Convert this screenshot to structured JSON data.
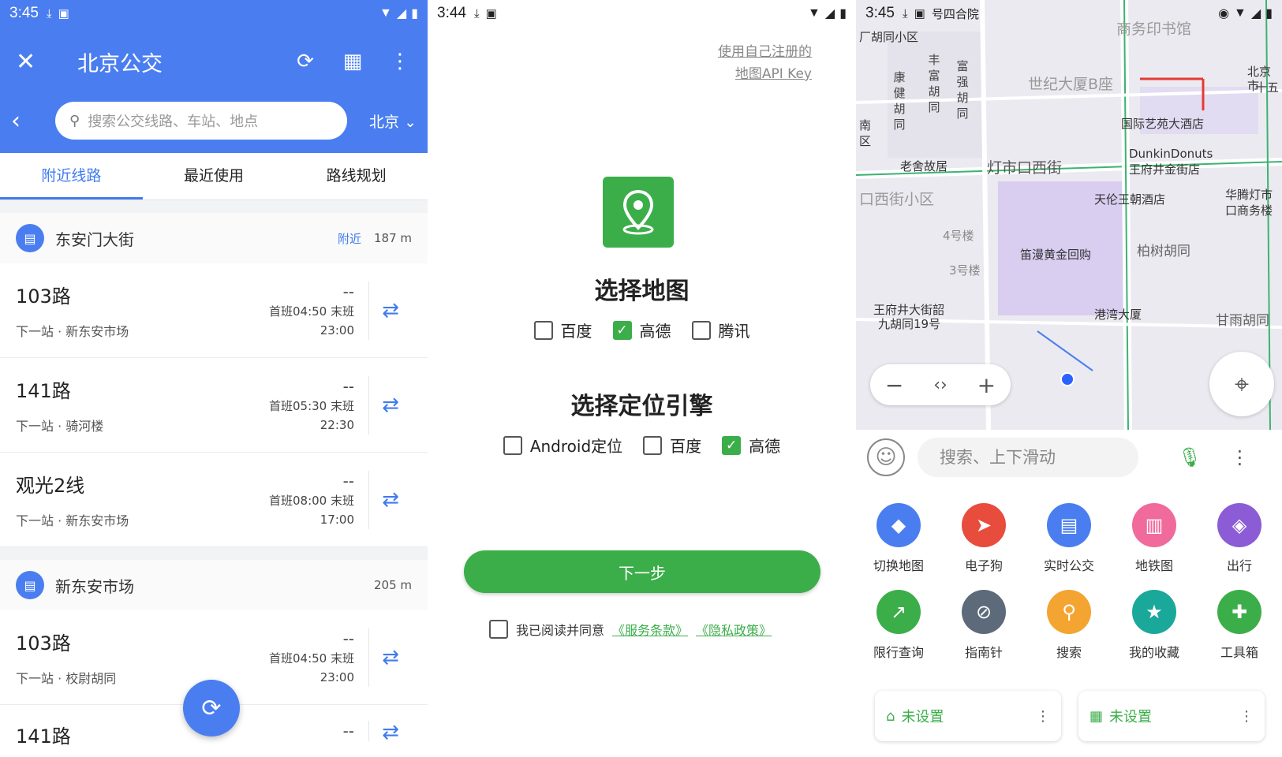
{
  "screen1": {
    "status_time": "3:45",
    "title": "北京公交",
    "search_placeholder": "搜索公交线路、车站、地点",
    "city": "北京",
    "tabs": [
      "附近线路",
      "最近使用",
      "路线规划"
    ],
    "stops": [
      {
        "name": "东安门大街",
        "near": "附近",
        "distance": "187 m",
        "routes": [
          {
            "name": "103路",
            "next": "下一站 · 新东安市场",
            "eta": "--",
            "first": "首班04:50 末班",
            "last": "23:00"
          },
          {
            "name": "141路",
            "next": "下一站 · 骑河楼",
            "eta": "--",
            "first": "首班05:30 末班",
            "last": "22:30"
          },
          {
            "name": "观光2线",
            "next": "下一站 · 新东安市场",
            "eta": "--",
            "first": "首班08:00 末班",
            "last": "17:00"
          }
        ]
      },
      {
        "name": "新东安市场",
        "near": "",
        "distance": "205 m",
        "routes": [
          {
            "name": "103路",
            "next": "下一站 · 校尉胡同",
            "eta": "--",
            "first": "首班04:50 末班",
            "last": "23:00"
          },
          {
            "name": "141路",
            "next": "",
            "eta": "--",
            "first": "",
            "last": ""
          }
        ]
      }
    ]
  },
  "screen2": {
    "status_time": "3:44",
    "register_link_line1": "使用自己注册的",
    "register_link_line2": "地图API Key",
    "map_heading": "选择地图",
    "map_options": [
      {
        "label": "百度",
        "checked": false
      },
      {
        "label": "高德",
        "checked": true
      },
      {
        "label": "腾讯",
        "checked": false
      }
    ],
    "engine_heading": "选择定位引擎",
    "engine_options": [
      {
        "label": "Android定位",
        "checked": false
      },
      {
        "label": "百度",
        "checked": false
      },
      {
        "label": "高德",
        "checked": true
      }
    ],
    "next_label": "下一步",
    "agree_text": "我已阅读并同意",
    "terms_link": "《服务条款》",
    "privacy_link": "《隐私政策》"
  },
  "screen3": {
    "status_time": "3:45",
    "status_extra": "号四合院",
    "map_labels": {
      "hutong_area": "厂胡同小区",
      "commercial_press": "商务印书馆",
      "century_tower": "世纪大厦B座",
      "intl_hotel": "国际艺苑大酒店",
      "laoshe": "老舍故居",
      "dengshikou_west": "灯市口西街",
      "dunkin": "DunkinDonuts",
      "wangfujing_store": "王府井金街店",
      "dengshikou_area": "口西街小区",
      "tianlun_hotel": "天伦王朝酒店",
      "huateng": "华腾灯市",
      "huateng2": "口商务楼",
      "bldg4": "4号楼",
      "bldg3": "3号楼",
      "dimaan": "笛漫黄金回购",
      "baishu": "柏树胡同",
      "wangfujing_addr1": "王府井大街韶",
      "wangfujing_addr2": "九胡同19号",
      "gangwan": "港湾大厦",
      "ganyu": "甘雨胡同",
      "south_area1": "南",
      "south_area2": "区",
      "beijing_city1": "北京市",
      "beijing_city2": "十五",
      "kangjian": "康健胡同",
      "fengfu": "丰富胡同",
      "fuqiang": "富强胡同"
    },
    "search_placeholder": "搜索、上下滑动",
    "grid": [
      {
        "label": "切换地图",
        "icon": "layers-icon",
        "color": "#4a7ef0"
      },
      {
        "label": "电子狗",
        "icon": "navigate-icon",
        "color": "#e84c3d"
      },
      {
        "label": "实时公交",
        "icon": "bus-icon",
        "color": "#4a7ef0"
      },
      {
        "label": "地铁图",
        "icon": "subway-icon",
        "color": "#f06a9b"
      },
      {
        "label": "出行",
        "icon": "directions-icon",
        "color": "#8c5cd6"
      },
      {
        "label": "限行查询",
        "icon": "restrict-icon",
        "color": "#3bae4a"
      },
      {
        "label": "指南针",
        "icon": "compass-icon",
        "color": "#5c6a79"
      },
      {
        "label": "搜索",
        "icon": "search-icon",
        "color": "#f4a431"
      },
      {
        "label": "我的收藏",
        "icon": "star-icon",
        "color": "#1aa89a"
      },
      {
        "label": "工具箱",
        "icon": "puzzle-icon",
        "color": "#3bae4a"
      }
    ],
    "home_label": "未设置",
    "work_label": "未设置"
  }
}
